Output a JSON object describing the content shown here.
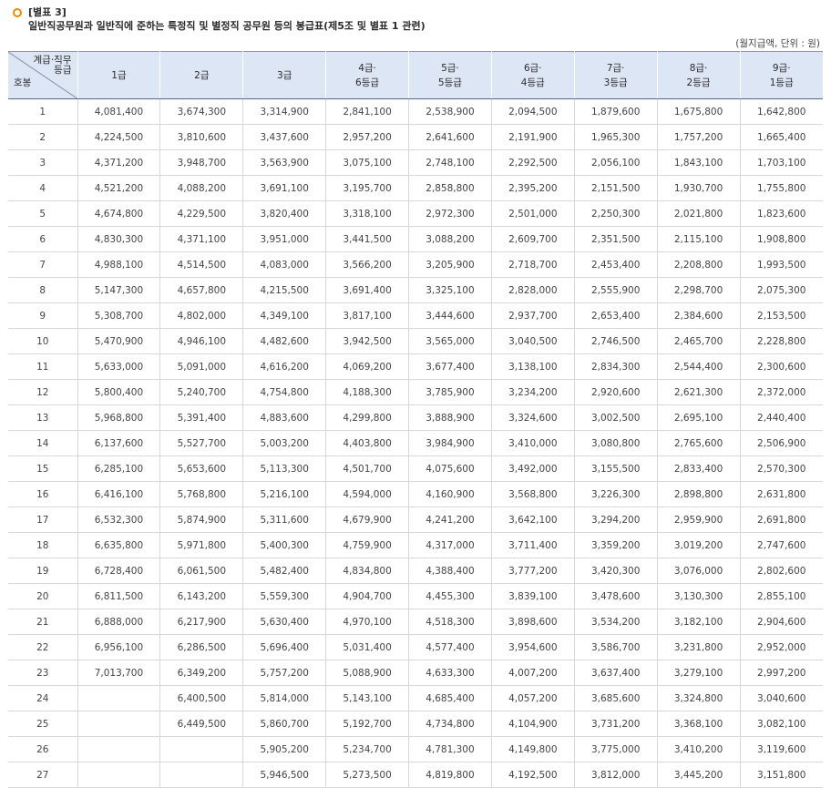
{
  "heading": {
    "tag": "[별표 3]",
    "title": "일반직공무원과 일반직에 준하는 특정직 및 별정직 공무원 등의 봉급표(제5조 및 별표 1 관련)",
    "unit_note": "(월지급액, 단위 : 원)"
  },
  "table": {
    "corner_top_line1": "계급·직무",
    "corner_top_line2": "등급",
    "corner_bottom": "호봉",
    "columns": [
      {
        "line1": "1급",
        "line2": ""
      },
      {
        "line1": "2급",
        "line2": ""
      },
      {
        "line1": "3급",
        "line2": ""
      },
      {
        "line1": "4급·",
        "line2": "6등급"
      },
      {
        "line1": "5급·",
        "line2": "5등급"
      },
      {
        "line1": "6급·",
        "line2": "4등급"
      },
      {
        "line1": "7급·",
        "line2": "3등급"
      },
      {
        "line1": "8급·",
        "line2": "2등급"
      },
      {
        "line1": "9급·",
        "line2": "1등급"
      }
    ],
    "rows": [
      {
        "step": "1",
        "values": [
          "4,081,400",
          "3,674,300",
          "3,314,900",
          "2,841,100",
          "2,538,900",
          "2,094,500",
          "1,879,600",
          "1,675,800",
          "1,642,800"
        ]
      },
      {
        "step": "2",
        "values": [
          "4,224,500",
          "3,810,600",
          "3,437,600",
          "2,957,200",
          "2,641,600",
          "2,191,900",
          "1,965,300",
          "1,757,200",
          "1,665,400"
        ]
      },
      {
        "step": "3",
        "values": [
          "4,371,200",
          "3,948,700",
          "3,563,900",
          "3,075,100",
          "2,748,100",
          "2,292,500",
          "2,056,100",
          "1,843,100",
          "1,703,100"
        ]
      },
      {
        "step": "4",
        "values": [
          "4,521,200",
          "4,088,200",
          "3,691,100",
          "3,195,700",
          "2,858,800",
          "2,395,200",
          "2,151,500",
          "1,930,700",
          "1,755,800"
        ]
      },
      {
        "step": "5",
        "values": [
          "4,674,800",
          "4,229,500",
          "3,820,400",
          "3,318,100",
          "2,972,300",
          "2,501,000",
          "2,250,300",
          "2,021,800",
          "1,823,600"
        ]
      },
      {
        "step": "6",
        "values": [
          "4,830,300",
          "4,371,100",
          "3,951,000",
          "3,441,500",
          "3,088,200",
          "2,609,700",
          "2,351,500",
          "2,115,100",
          "1,908,800"
        ]
      },
      {
        "step": "7",
        "values": [
          "4,988,100",
          "4,514,500",
          "4,083,000",
          "3,566,200",
          "3,205,900",
          "2,718,700",
          "2,453,400",
          "2,208,800",
          "1,993,500"
        ]
      },
      {
        "step": "8",
        "values": [
          "5,147,300",
          "4,657,800",
          "4,215,500",
          "3,691,400",
          "3,325,100",
          "2,828,000",
          "2,555,900",
          "2,298,700",
          "2,075,300"
        ]
      },
      {
        "step": "9",
        "values": [
          "5,308,700",
          "4,802,000",
          "4,349,100",
          "3,817,100",
          "3,444,600",
          "2,937,700",
          "2,653,400",
          "2,384,600",
          "2,153,500"
        ]
      },
      {
        "step": "10",
        "values": [
          "5,470,900",
          "4,946,100",
          "4,482,600",
          "3,942,500",
          "3,565,000",
          "3,040,500",
          "2,746,500",
          "2,465,700",
          "2,228,800"
        ]
      },
      {
        "step": "11",
        "values": [
          "5,633,000",
          "5,091,000",
          "4,616,200",
          "4,069,200",
          "3,677,400",
          "3,138,100",
          "2,834,300",
          "2,544,400",
          "2,300,600"
        ]
      },
      {
        "step": "12",
        "values": [
          "5,800,400",
          "5,240,700",
          "4,754,800",
          "4,188,300",
          "3,785,900",
          "3,234,200",
          "2,920,600",
          "2,621,300",
          "2,372,000"
        ]
      },
      {
        "step": "13",
        "values": [
          "5,968,800",
          "5,391,400",
          "4,883,600",
          "4,299,800",
          "3,888,900",
          "3,324,600",
          "3,002,500",
          "2,695,100",
          "2,440,400"
        ]
      },
      {
        "step": "14",
        "values": [
          "6,137,600",
          "5,527,700",
          "5,003,200",
          "4,403,800",
          "3,984,900",
          "3,410,000",
          "3,080,800",
          "2,765,600",
          "2,506,900"
        ]
      },
      {
        "step": "15",
        "values": [
          "6,285,100",
          "5,653,600",
          "5,113,300",
          "4,501,700",
          "4,075,600",
          "3,492,000",
          "3,155,500",
          "2,833,400",
          "2,570,300"
        ]
      },
      {
        "step": "16",
        "values": [
          "6,416,100",
          "5,768,800",
          "5,216,100",
          "4,594,000",
          "4,160,900",
          "3,568,800",
          "3,226,300",
          "2,898,800",
          "2,631,800"
        ]
      },
      {
        "step": "17",
        "values": [
          "6,532,300",
          "5,874,900",
          "5,311,600",
          "4,679,900",
          "4,241,200",
          "3,642,100",
          "3,294,200",
          "2,959,900",
          "2,691,800"
        ]
      },
      {
        "step": "18",
        "values": [
          "6,635,800",
          "5,971,800",
          "5,400,300",
          "4,759,900",
          "4,317,000",
          "3,711,400",
          "3,359,200",
          "3,019,200",
          "2,747,600"
        ]
      },
      {
        "step": "19",
        "values": [
          "6,728,400",
          "6,061,500",
          "5,482,400",
          "4,834,800",
          "4,388,400",
          "3,777,200",
          "3,420,300",
          "3,076,000",
          "2,802,600"
        ]
      },
      {
        "step": "20",
        "values": [
          "6,811,500",
          "6,143,200",
          "5,559,300",
          "4,904,700",
          "4,455,300",
          "3,839,100",
          "3,478,600",
          "3,130,300",
          "2,855,100"
        ]
      },
      {
        "step": "21",
        "values": [
          "6,888,000",
          "6,217,900",
          "5,630,400",
          "4,970,100",
          "4,518,300",
          "3,898,600",
          "3,534,200",
          "3,182,100",
          "2,904,600"
        ]
      },
      {
        "step": "22",
        "values": [
          "6,956,100",
          "6,286,500",
          "5,696,400",
          "5,031,400",
          "4,577,400",
          "3,954,600",
          "3,586,700",
          "3,231,800",
          "2,952,000"
        ]
      },
      {
        "step": "23",
        "values": [
          "7,013,700",
          "6,349,200",
          "5,757,200",
          "5,088,900",
          "4,633,300",
          "4,007,200",
          "3,637,400",
          "3,279,100",
          "2,997,200"
        ]
      },
      {
        "step": "24",
        "values": [
          "",
          "6,400,500",
          "5,814,000",
          "5,143,100",
          "4,685,400",
          "4,057,200",
          "3,685,600",
          "3,324,800",
          "3,040,600"
        ]
      },
      {
        "step": "25",
        "values": [
          "",
          "6,449,500",
          "5,860,700",
          "5,192,700",
          "4,734,800",
          "4,104,900",
          "3,731,200",
          "3,368,100",
          "3,082,100"
        ]
      },
      {
        "step": "26",
        "values": [
          "",
          "",
          "5,905,200",
          "5,234,700",
          "4,781,300",
          "4,149,800",
          "3,775,000",
          "3,410,200",
          "3,119,600"
        ]
      },
      {
        "step": "27",
        "values": [
          "",
          "",
          "5,946,500",
          "5,273,500",
          "4,819,800",
          "4,192,500",
          "3,812,000",
          "3,445,200",
          "3,151,800"
        ]
      }
    ]
  }
}
